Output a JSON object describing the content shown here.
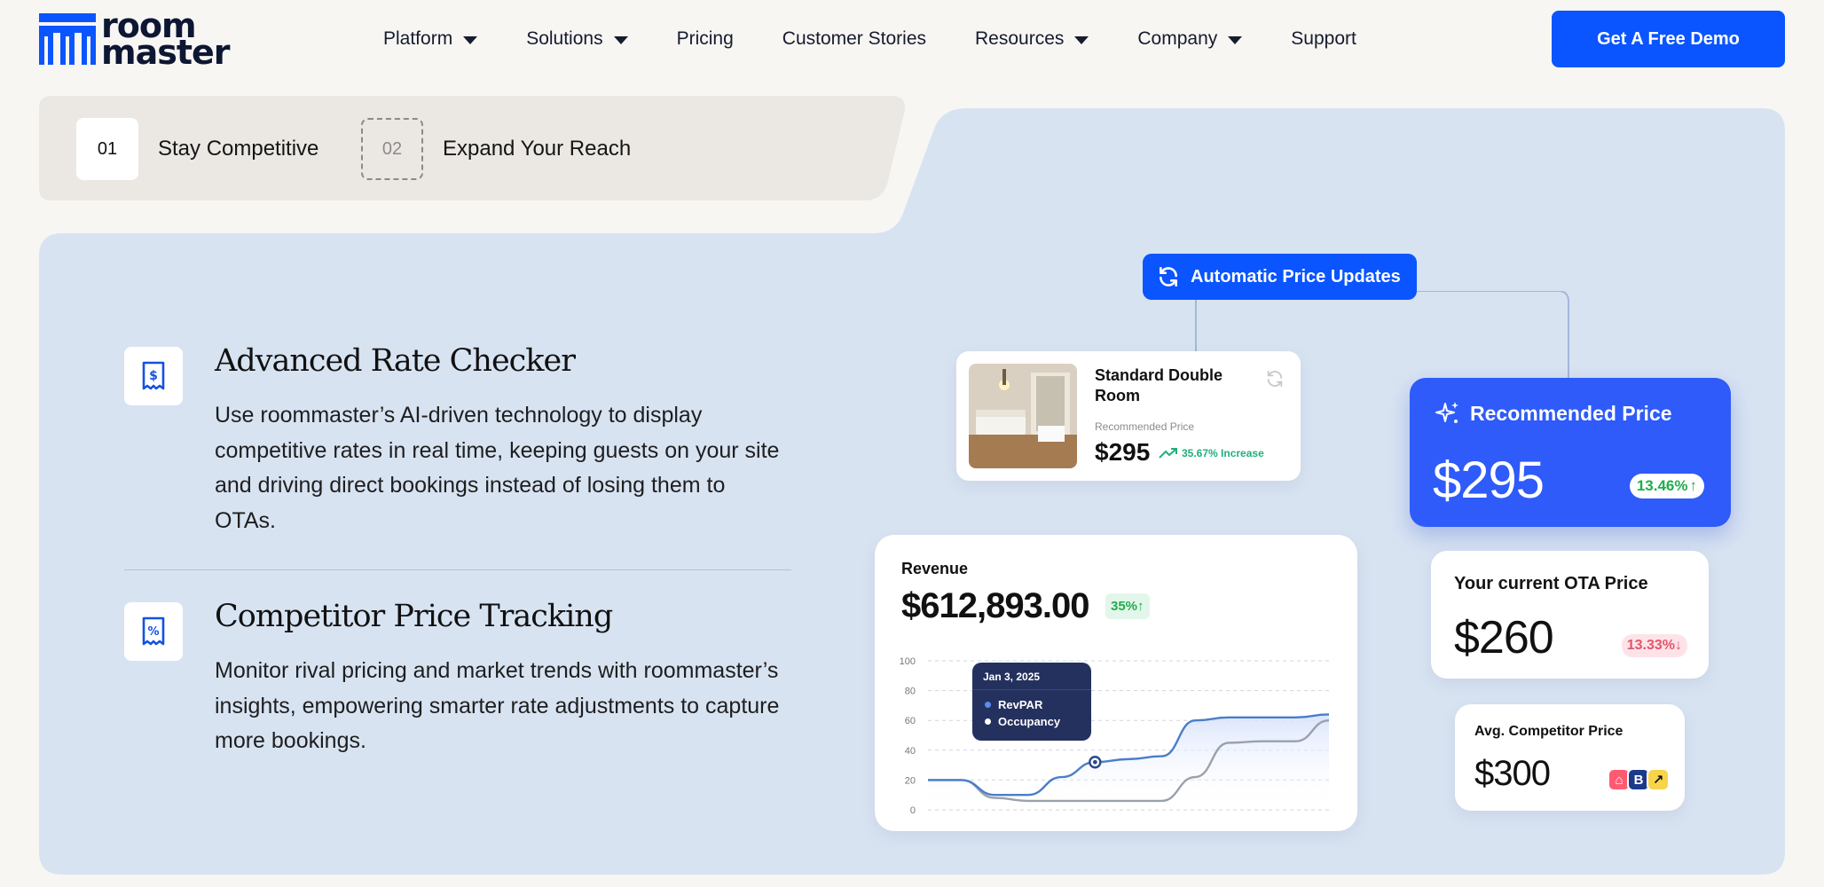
{
  "brand": {
    "line1": "room",
    "line2": "master",
    "color": "#0a55ff"
  },
  "nav": {
    "items": [
      {
        "label": "Platform",
        "dropdown": true
      },
      {
        "label": "Solutions",
        "dropdown": true
      },
      {
        "label": "Pricing",
        "dropdown": false
      },
      {
        "label": "Customer Stories",
        "dropdown": false
      },
      {
        "label": "Resources",
        "dropdown": true
      },
      {
        "label": "Company",
        "dropdown": true
      },
      {
        "label": "Support",
        "dropdown": false
      }
    ],
    "cta": "Get A Free Demo"
  },
  "tabs": [
    {
      "num": "01",
      "label": "Stay Competitive",
      "active": true
    },
    {
      "num": "02",
      "label": "Expand Your Reach",
      "active": false
    }
  ],
  "features": [
    {
      "icon": "dollar-receipt-icon",
      "title": "Advanced Rate Checker",
      "description": "Use roommaster’s AI-driven technology to display competitive rates in real time, keeping guests on your site and driving direct bookings instead of losing them to OTAs."
    },
    {
      "icon": "percent-receipt-icon",
      "title": "Competitor Price Tracking",
      "description": "Monitor rival pricing and market trends with roommaster’s insights, empowering smarter rate adjustments to capture more bookings."
    }
  ],
  "visual": {
    "auto_badge": "Automatic Price Updates",
    "room": {
      "title": "Standard Double Room",
      "rec_label": "Recommended Price",
      "price": "$295",
      "increase": "35.67% Increase"
    },
    "recommended": {
      "title": "Recommended Price",
      "price": "$295",
      "change": "13.46%"
    },
    "ota": {
      "title": "Your current OTA Price",
      "price": "$260",
      "change": "13.33%"
    },
    "competitor": {
      "title": "Avg. Competitor Price",
      "price": "$300",
      "logos": [
        "A",
        "B",
        "↗"
      ]
    },
    "revenue": {
      "label": "Revenue",
      "value": "$612,893.00",
      "change": "35%",
      "tooltip": {
        "date": "Jan 3, 2025",
        "items": [
          "RevPAR",
          "Occupancy"
        ]
      }
    }
  },
  "chart_data": {
    "type": "line",
    "ylim": [
      0,
      100
    ],
    "yticks": [
      0,
      20,
      40,
      60,
      80,
      100
    ],
    "x": [
      0,
      1,
      2,
      3,
      4,
      5,
      6,
      7,
      8,
      9,
      10,
      11,
      12
    ],
    "series": [
      {
        "name": "RevPAR",
        "color": "#4a7ec9",
        "values": [
          20,
          20,
          10,
          10,
          22,
          32,
          34,
          36,
          60,
          62,
          62,
          62,
          64
        ]
      },
      {
        "name": "Occupancy",
        "color": "#9aa1ad",
        "values": [
          20,
          20,
          8,
          6,
          6,
          6,
          6,
          6,
          22,
          45,
          46,
          46,
          60
        ]
      }
    ],
    "grid": true
  }
}
